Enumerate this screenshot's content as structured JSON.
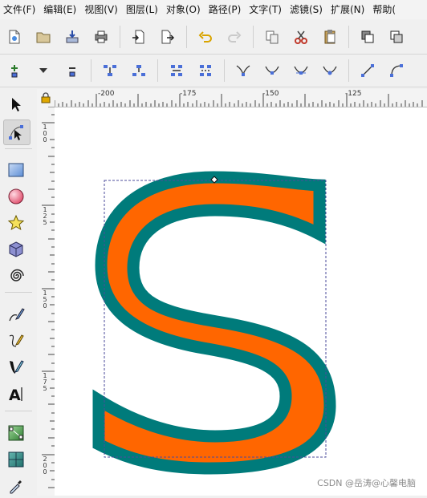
{
  "menubar": {
    "items": [
      "文件(F)",
      "编辑(E)",
      "视图(V)",
      "图层(L)",
      "对象(O)",
      "路径(P)",
      "文字(T)",
      "滤镜(S)",
      "扩展(N)",
      "帮助("
    ]
  },
  "rulers": {
    "horizontal_labels": [
      "-200",
      "-175",
      "-150",
      "-125"
    ],
    "vertical_labels": [
      [
        "1",
        "0",
        "0"
      ],
      [
        "1",
        "2",
        "5"
      ],
      [
        "1",
        "5",
        "0"
      ],
      [
        "1",
        "7",
        "5"
      ],
      [
        "2",
        "0",
        "0"
      ]
    ]
  },
  "canvas": {
    "fill_color": "#ff6600",
    "stroke_color": "#007b7b",
    "bbox_color": "#4b4b9b"
  },
  "watermark": "CSDN @岳涛@心馨电脑",
  "colors": {
    "node_blue": "#2f5bd0",
    "toolbar_bg": "#f0f0f0"
  }
}
